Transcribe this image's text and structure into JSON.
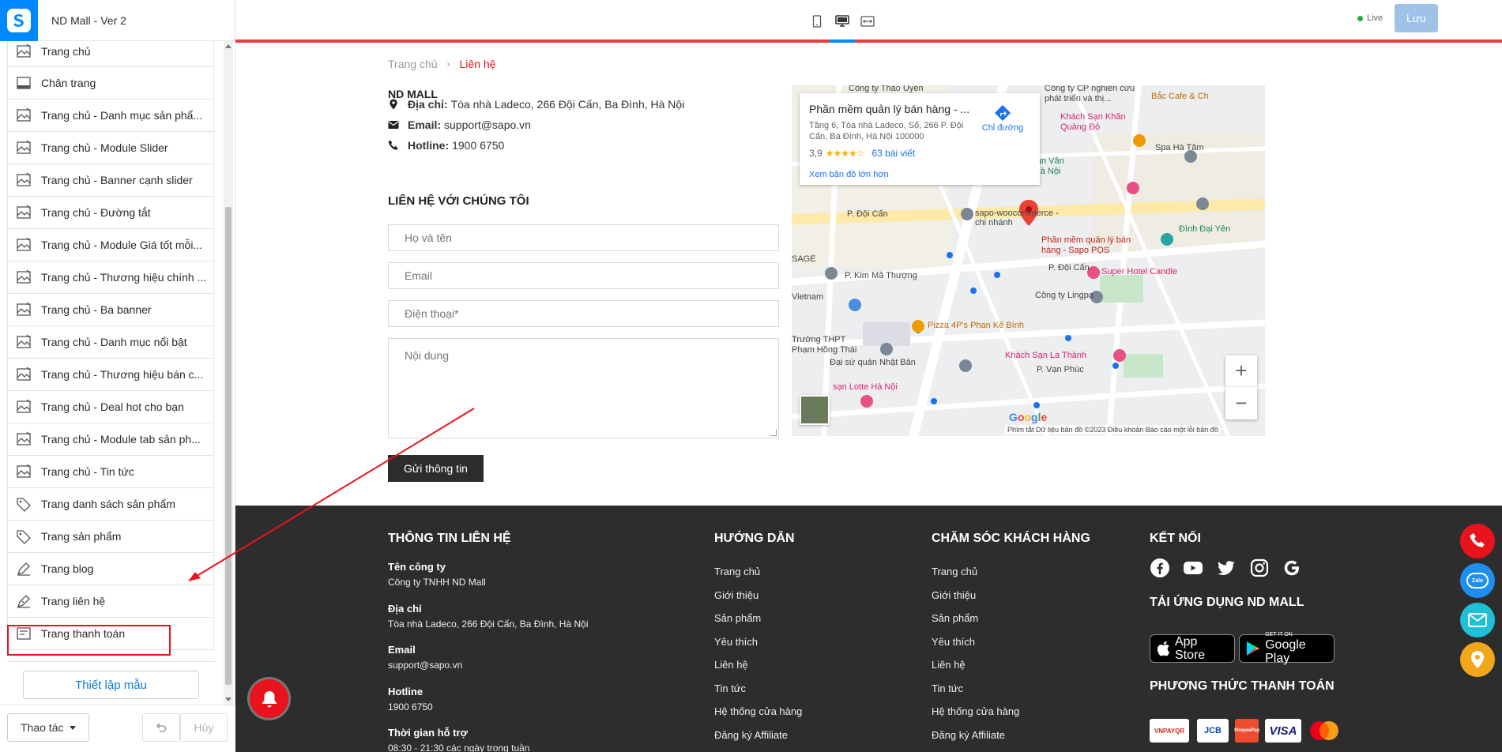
{
  "app": {
    "title": "ND Mall - Ver 2",
    "logo_icon": "sapo-logo-icon",
    "brand_color": "#0088ff"
  },
  "sidebar": {
    "items": [
      {
        "label": "Trang chủ",
        "icon": "template-icon"
      },
      {
        "label": "Chân trang",
        "icon": "footer-icon"
      },
      {
        "label": "Trang chủ - Danh mục sản phẩ...",
        "icon": "template-icon"
      },
      {
        "label": "Trang chủ - Module Slider",
        "icon": "template-icon"
      },
      {
        "label": "Trang chủ - Banner cạnh slider",
        "icon": "template-icon"
      },
      {
        "label": "Trang chủ - Đường tắt",
        "icon": "template-icon"
      },
      {
        "label": "Trang chủ - Module Giá tốt mỗi...",
        "icon": "template-icon"
      },
      {
        "label": "Trang chủ - Thương hiệu chính ...",
        "icon": "template-icon"
      },
      {
        "label": "Trang chủ - Ba banner",
        "icon": "template-icon"
      },
      {
        "label": "Trang chủ - Danh mục nổi bật",
        "icon": "template-icon"
      },
      {
        "label": "Trang chủ - Thương hiệu bán c...",
        "icon": "template-icon"
      },
      {
        "label": "Trang chủ - Deal hot cho bạn",
        "icon": "template-icon"
      },
      {
        "label": "Trang chủ - Module tab sản ph...",
        "icon": "template-icon"
      },
      {
        "label": "Trang chủ - Tin tức",
        "icon": "template-icon"
      },
      {
        "label": "Trang danh sách sản phẩm",
        "icon": "tag-icon"
      },
      {
        "label": "Trang sản phẩm",
        "icon": "tag-icon"
      },
      {
        "label": "Trang blog",
        "icon": "blog-icon"
      },
      {
        "label": "Trang liên hệ",
        "icon": "contact-icon"
      },
      {
        "label": "Trang thanh toán",
        "icon": "checkout-icon"
      }
    ],
    "setup_button": "Thiết lập mẫu",
    "actions_button": "Thao tác",
    "redo_button": "Hủy"
  },
  "topbar": {
    "devices": [
      "mobile-icon",
      "desktop-icon",
      "fullwidth-icon"
    ],
    "active_device": "desktop-icon",
    "status": "Live",
    "status_color": "#28a745",
    "save_button": "Lưu"
  },
  "page": {
    "breadcrumb": {
      "home": "Trang chủ",
      "separator": "›",
      "current": "Liên hệ"
    },
    "store_name": "ND MALL",
    "contact": {
      "address_label": "Địa chỉ:",
      "address_value": "Tòa nhà Ladeco, 266 Đội Cấn, Ba Đình, Hà Nội",
      "email_label": "Email:",
      "email_value": "support@sapo.vn",
      "hotline_label": "Hotline:",
      "hotline_value": "1900 6750"
    },
    "form": {
      "heading": "LIÊN HỆ VỚI CHÚNG TÔI",
      "name_placeholder": "Họ và tên",
      "email_placeholder": "Email",
      "phone_placeholder": "Điện thoại*",
      "message_placeholder": "Nội dung",
      "submit": "Gửi thông tin"
    },
    "accent_color": "#e8131c"
  },
  "map": {
    "card_title": "Phần mềm quản lý bán hàng - ...",
    "card_address": "Tầng 6, Tòa nhà Ladeco, Số, 266 P. Đội Cấn, Ba Đình, Hà Nội 100000",
    "rating": "3,9",
    "stars": "★★★★☆",
    "reviews": "63 bài viết",
    "larger_map": "Xem bản đồ lớn hơn",
    "directions": "Chỉ đường",
    "zoom_in": "+",
    "zoom_out": "−",
    "google": "Google",
    "footer_text": "Phím tắt   Dữ liệu bản đồ ©2023   Điều khoản   Báo cáo một lỗi bản đồ",
    "labels": {
      "l1": "Công ty Thảo Uyên",
      "l2": "Công ty CP nghiên cứu phát triển và thị...",
      "l3": "Bắc Cafe & Ch",
      "l4": "Khách Sạn Khăn Quàng Đỏ",
      "l5": "Spa Hà Tâm",
      "l6": "Làng Bán Văn Phẩm Hà Nội",
      "l7": "P. Đội Cấn",
      "l8": "sapo-woocommerce - chi nhánh",
      "l9": "Đình Đại Yên",
      "l10": "Phần mềm quản lý bán hàng - Sapo POS",
      "l11": "SAGE",
      "l12": "Super Hotel Candle",
      "l13": "P. Kim Mã Thượng",
      "l14": "P. Đội Cấn",
      "l15": "Công ty Lingpa",
      "l16": "Vietnam",
      "l17": "Pizza 4P's Phan Kế Bính",
      "l18": "Trường THPT Phạm Hồng Thái",
      "l19": "Khách Sạn La Thành",
      "l20": "Đại sứ quán Nhật Bản",
      "l21": "P. Vạn Phúc",
      "l22": "sạn Lotte Hà Nội"
    }
  },
  "footer": {
    "col1": {
      "title": "THÔNG TIN LIÊN HỆ",
      "company_label": "Tên công ty",
      "company_value": "Công ty TNHH ND Mall",
      "address_label": "Địa chỉ",
      "address_value": "Tòa nhà Ladeco, 266 Đội Cấn, Ba Đình, Hà Nội",
      "email_label": "Email",
      "email_value": "support@sapo.vn",
      "hotline_label": "Hotline",
      "hotline_value": "1900 6750",
      "hours_label": "Thời gian hỗ trợ",
      "hours_value": "08:30 - 21:30 các ngày trong tuần"
    },
    "col2": {
      "title": "HƯỚNG DẪN",
      "links": [
        "Trang chủ",
        "Giới thiệu",
        "Sản phẩm",
        "Yêu thích",
        "Liên hệ",
        "Tin tức",
        "Hệ thống cửa hàng",
        "Đăng ký Affiliate"
      ]
    },
    "col3": {
      "title": "CHĂM SÓC KHÁCH HÀNG",
      "links": [
        "Trang chủ",
        "Giới thiệu",
        "Sản phẩm",
        "Yêu thích",
        "Liên hệ",
        "Tin tức",
        "Hệ thống cửa hàng",
        "Đăng ký Affiliate"
      ]
    },
    "col4": {
      "title": "KẾT NỐI",
      "socials": [
        "facebook-icon",
        "youtube-icon",
        "twitter-icon",
        "instagram-icon",
        "google-icon"
      ],
      "app_title": "TẢI ỨNG DỤNG ND MALL",
      "appstore": "App Store",
      "googleplay_small": "GET IT ON",
      "googleplay": "Google Play",
      "payment_title": "PHƯƠNG THỨC THANH TOÁN",
      "payments": [
        "VNPAYQR",
        "JCB",
        "ShopeePay",
        "VISA",
        "Mastercard"
      ]
    },
    "background": "#2d2d2d"
  },
  "floating": {
    "buttons": [
      "phone-icon",
      "zalo-icon",
      "mail-icon",
      "location-icon"
    ],
    "zalo_text": "Zalo",
    "bell": "bell-icon"
  }
}
